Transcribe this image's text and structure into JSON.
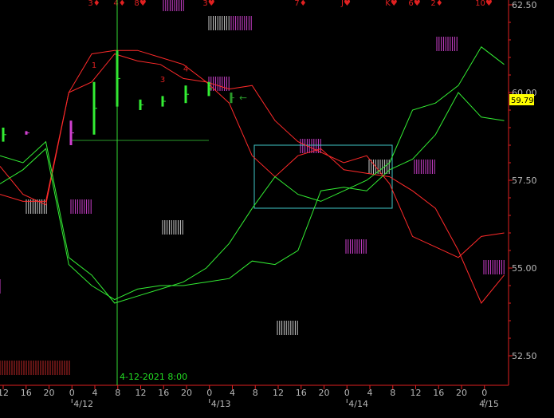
{
  "chart_data": {
    "type": "line",
    "x_tick_labels": [
      "12",
      "16",
      "20",
      "0",
      "4",
      "8",
      "12",
      "16",
      "20",
      "0",
      "4",
      "8",
      "12",
      "16",
      "20",
      "0",
      "4",
      "8",
      "12",
      "16",
      "20",
      "0"
    ],
    "date_labels": [
      "4/12",
      "4/13",
      "4/14",
      "4/15"
    ],
    "ylim": [
      51.6,
      62.5
    ],
    "y_ticks": [
      "62.50",
      "60.00",
      "57.50",
      "55.00",
      "52.50"
    ],
    "last_price": "59.79",
    "cursor_label": "4-12-2021 8:00",
    "card_labels": [
      "3♦",
      "4♦",
      "8♥",
      "3♥",
      "7♦",
      "J♥",
      "K♥",
      "6♥",
      "2♦",
      "10♥"
    ],
    "bar_numbers": [
      "1",
      "3",
      "4"
    ],
    "colors": {
      "background": "#000000",
      "axis": "#e02020",
      "red_line": "#ff2a2a",
      "green_line": "#33ee33",
      "magenta": "#d040d0",
      "white_bars": "#cccccc",
      "box": "#40c8c8",
      "cursor": "#33dd33",
      "last_price_bg": "#ffff00"
    },
    "series": [
      {
        "color": "red",
        "values": [
          57.9,
          57.1,
          56.8,
          60.0,
          61.1,
          61.2,
          61.2,
          61.0,
          60.8,
          60.3,
          59.7,
          58.2,
          57.6,
          58.2,
          58.4,
          57.8,
          57.7,
          57.6,
          57.2,
          56.7,
          55.5,
          54.0,
          54.8
        ]
      },
      {
        "color": "red",
        "values": [
          57.1,
          56.9,
          56.9,
          60.0,
          60.3,
          61.1,
          60.9,
          60.8,
          60.4,
          60.3,
          60.1,
          60.2,
          59.2,
          58.6,
          58.3,
          58.0,
          58.2,
          57.4,
          55.9,
          55.6,
          55.3,
          55.9,
          56.0
        ]
      },
      {
        "color": "green",
        "values": [
          58.2,
          58.0,
          58.6,
          55.3,
          54.8,
          54.0,
          54.2,
          54.4,
          54.6,
          55.0,
          55.7,
          56.7,
          57.6,
          57.1,
          56.9,
          57.2,
          57.5,
          58.0,
          59.5,
          59.7,
          60.2,
          61.3,
          60.8
        ]
      },
      {
        "color": "green",
        "values": [
          57.4,
          57.8,
          58.4,
          55.1,
          54.5,
          54.1,
          54.4,
          54.5,
          54.5,
          54.6,
          54.7,
          55.2,
          55.1,
          55.5,
          57.2,
          57.3,
          57.2,
          57.8,
          58.1,
          58.8,
          60.0,
          59.3,
          59.2
        ]
      }
    ]
  }
}
